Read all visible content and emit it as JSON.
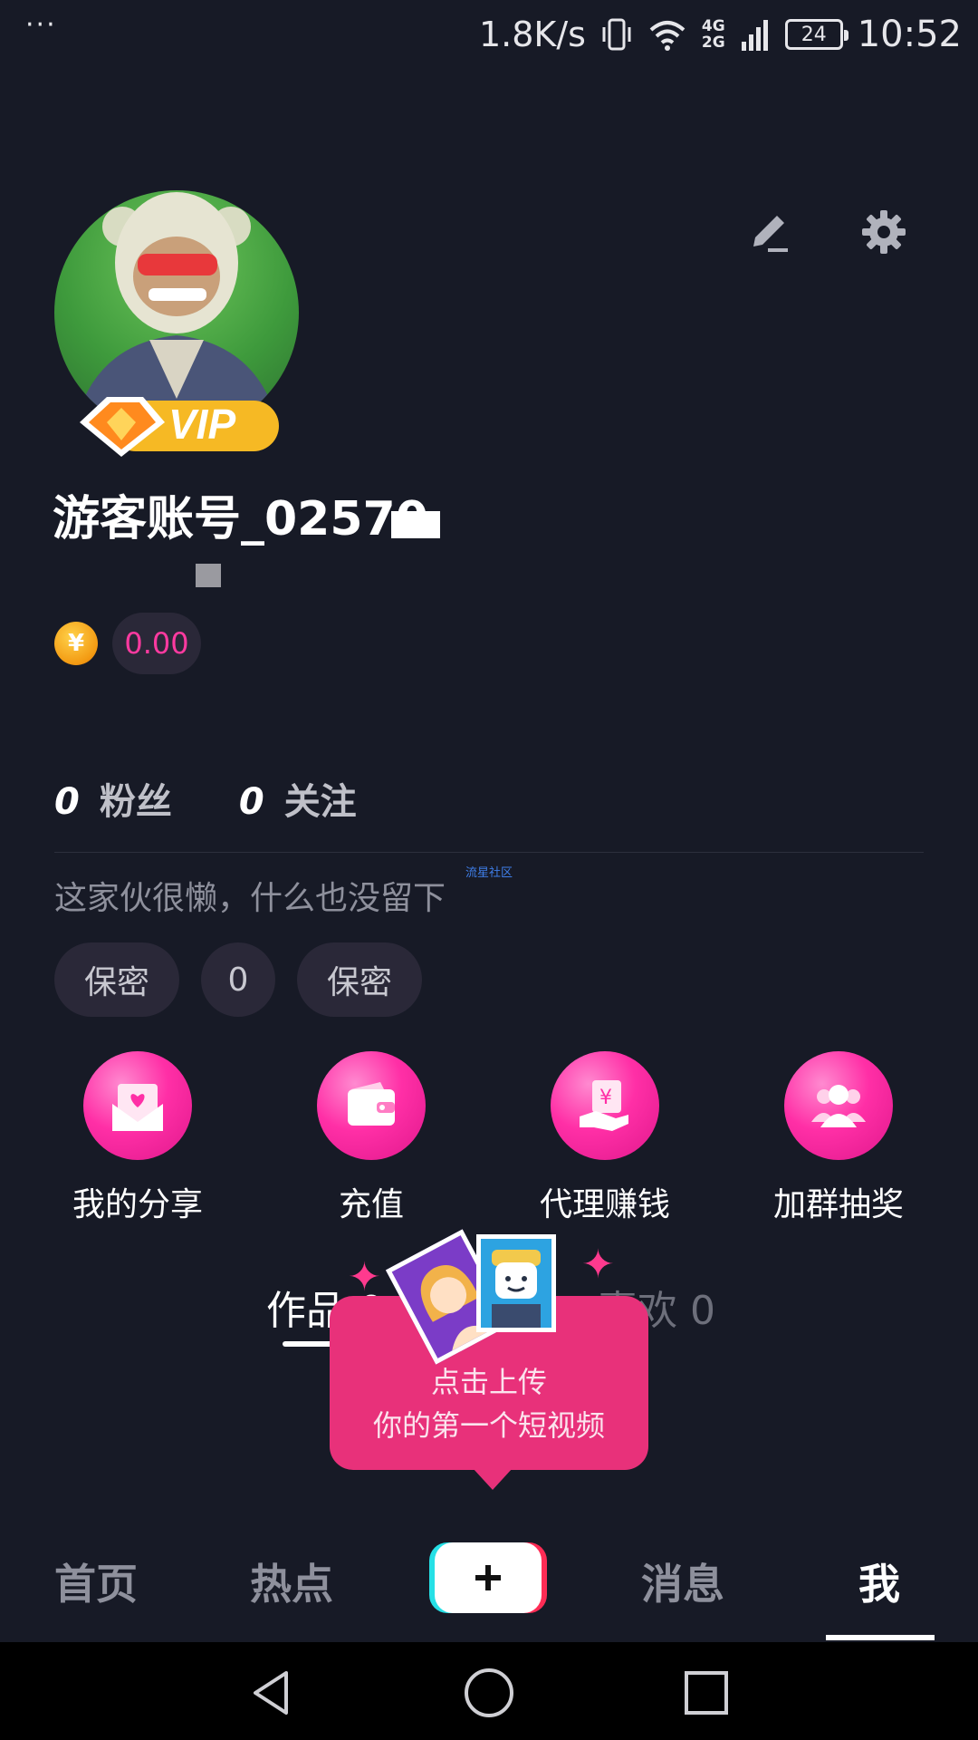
{
  "status_bar": {
    "menu_dots": "···",
    "net_speed": "1.8K/s",
    "net_top": "4G",
    "net_bottom": "2G",
    "battery": "24",
    "time": "10:52"
  },
  "profile": {
    "username": "游客账号_02570",
    "balance": "0.00",
    "coin_symbol": "¥",
    "vip_label": "VIP",
    "followers_count": "0",
    "followers_label": "粉丝",
    "following_count": "0",
    "following_label": "关注",
    "bio": "这家伙很懒，什么也没留下",
    "bio_watermark": "流星社区",
    "tags": [
      "保密",
      "0",
      "保密"
    ]
  },
  "actions": [
    {
      "label": "我的分享",
      "icon": "share-envelope-icon"
    },
    {
      "label": "充值",
      "icon": "wallet-icon"
    },
    {
      "label": "代理赚钱",
      "icon": "hand-money-icon"
    },
    {
      "label": "加群抽奖",
      "icon": "group-icon"
    }
  ],
  "tabs": {
    "works": "作品 0",
    "likes": "喜欢 0"
  },
  "tooltip": {
    "line1": "点击上传",
    "line2": "你的第一个短视频"
  },
  "bottom_nav": {
    "home": "首页",
    "hot": "热点",
    "messages": "消息",
    "me": "我"
  },
  "colors": {
    "background": "#171a26",
    "accent_pink": "#ff2fa6",
    "tooltip": "#e8317a"
  }
}
